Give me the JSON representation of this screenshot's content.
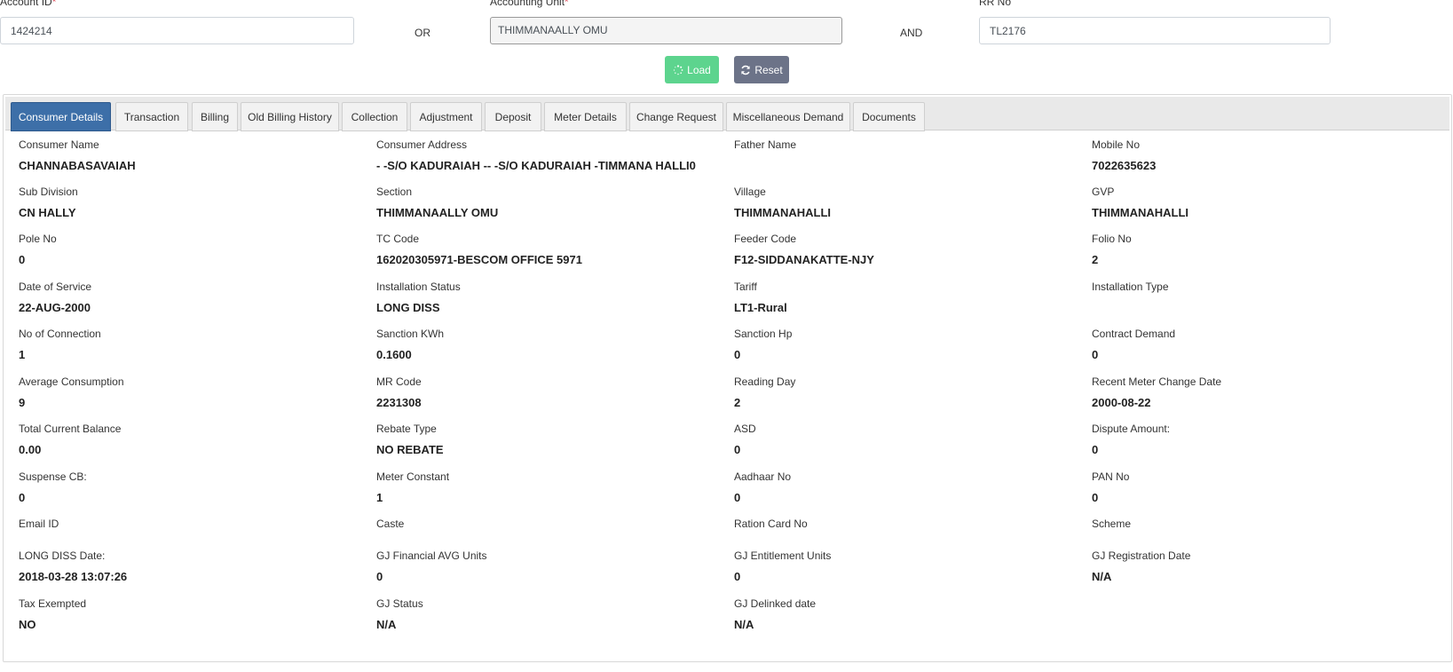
{
  "search": {
    "account_id_label": "Account ID",
    "account_id_value": "1424214",
    "or_label": "OR",
    "accounting_unit_label": "Accounting Unit",
    "accounting_unit_value": "THIMMANAALLY OMU",
    "and_label": "AND",
    "rr_no_label": "RR No",
    "rr_no_value": "TL2176",
    "required_mark": "*"
  },
  "buttons": {
    "load_label": "Load",
    "reset_label": "Reset"
  },
  "tabs": [
    {
      "label": "Consumer Details",
      "active": true
    },
    {
      "label": "Transaction"
    },
    {
      "label": "Billing"
    },
    {
      "label": "Old Billing History"
    },
    {
      "label": "Collection"
    },
    {
      "label": "Adjustment"
    },
    {
      "label": "Deposit"
    },
    {
      "label": "Meter Details"
    },
    {
      "label": "Change Request"
    },
    {
      "label": "Miscellaneous Demand"
    },
    {
      "label": "Documents"
    }
  ],
  "details": [
    [
      {
        "label": "Consumer Name",
        "value": "CHANNABASAVAIAH"
      },
      {
        "label": "Consumer Address",
        "value": "- -S/O KADURAIAH -- -S/O KADURAIAH -TIMMANA HALLI0"
      },
      {
        "label": "Father Name",
        "value": ""
      },
      {
        "label": "Mobile No",
        "value": "7022635623"
      }
    ],
    [
      {
        "label": "Sub Division",
        "value": "CN HALLY"
      },
      {
        "label": "Section",
        "value": "THIMMANAALLY OMU"
      },
      {
        "label": "Village",
        "value": "THIMMANAHALLI"
      },
      {
        "label": "GVP",
        "value": "THIMMANAHALLI"
      }
    ],
    [
      {
        "label": "Pole No",
        "value": "0"
      },
      {
        "label": "TC Code",
        "value": "162020305971-BESCOM OFFICE 5971"
      },
      {
        "label": "Feeder Code",
        "value": "F12-SIDDANAKATTE-NJY"
      },
      {
        "label": "Folio No",
        "value": "2"
      }
    ],
    [
      {
        "label": "Date of Service",
        "value": "22-AUG-2000"
      },
      {
        "label": "Installation Status",
        "value": "LONG DISS"
      },
      {
        "label": "Tariff",
        "value": "LT1-Rural"
      },
      {
        "label": "Installation Type",
        "value": ""
      }
    ],
    [
      {
        "label": "No of Connection",
        "value": "1"
      },
      {
        "label": "Sanction KWh",
        "value": "0.1600"
      },
      {
        "label": "Sanction Hp",
        "value": "0"
      },
      {
        "label": "Contract Demand",
        "value": "0"
      }
    ],
    [
      {
        "label": "Average Consumption",
        "value": "9"
      },
      {
        "label": "MR Code",
        "value": "2231308"
      },
      {
        "label": "Reading Day",
        "value": "2"
      },
      {
        "label": "Recent Meter Change Date",
        "value": "2000-08-22"
      }
    ],
    [
      {
        "label": "Total Current Balance",
        "value": "0.00"
      },
      {
        "label": "Rebate Type",
        "value": "NO REBATE"
      },
      {
        "label": "ASD",
        "value": "0"
      },
      {
        "label": "Dispute Amount:",
        "value": "0"
      }
    ],
    [
      {
        "label": "Suspense CB:",
        "value": "0"
      },
      {
        "label": "Meter Constant",
        "value": "1"
      },
      {
        "label": "Aadhaar No",
        "value": "0"
      },
      {
        "label": "PAN No",
        "value": "0"
      }
    ],
    [
      {
        "label": "Email ID",
        "value": ""
      },
      {
        "label": "Caste",
        "value": ""
      },
      {
        "label": "Ration Card No",
        "value": ""
      },
      {
        "label": "Scheme",
        "value": ""
      }
    ],
    [
      {
        "label": "LONG DISS Date:",
        "value": "2018-03-28 13:07:26"
      },
      {
        "label": "GJ Financial AVG Units",
        "value": "0"
      },
      {
        "label": "GJ Entitlement Units",
        "value": "0"
      },
      {
        "label": "GJ Registration Date",
        "value": "N/A"
      }
    ],
    [
      {
        "label": "Tax Exempted",
        "value": "NO"
      },
      {
        "label": "GJ Status",
        "value": "N/A"
      },
      {
        "label": "GJ Delinked date",
        "value": "N/A"
      }
    ]
  ],
  "colors": {
    "active_tab": "#3d6fa8",
    "load_button": "#5dd48e",
    "reset_button": "#6c7388",
    "required": "#dc3545"
  }
}
